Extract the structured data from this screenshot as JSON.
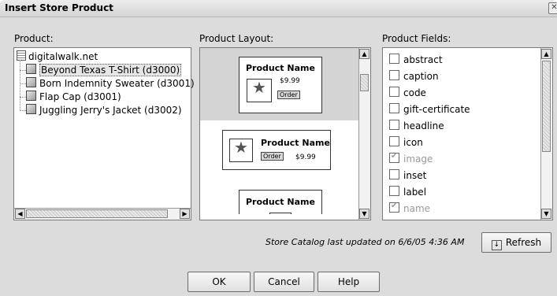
{
  "window": {
    "title": "Insert Store Product",
    "close_icon": "close-icon"
  },
  "product": {
    "label": "Product:",
    "root": "digitalwalk.net",
    "items": [
      {
        "label": "Beyond Texas T-Shirt (d3000)",
        "selected": true
      },
      {
        "label": "Born Indemnity Sweater (d3001)"
      },
      {
        "label": "Flap Cap (d3001)"
      },
      {
        "label": "Juggling Jerry's Jacket (d3002)"
      }
    ]
  },
  "layout": {
    "label": "Product Layout:",
    "cards": [
      {
        "name": "Product Name",
        "price": "$9.99",
        "button": "Order"
      },
      {
        "name": "Product Name",
        "price": "$9.99",
        "button": "Order"
      },
      {
        "name": "Product Name"
      }
    ]
  },
  "fields": {
    "label": "Product Fields:",
    "items": [
      {
        "label": "abstract",
        "checked": false,
        "disabled": false
      },
      {
        "label": "caption",
        "checked": false,
        "disabled": false
      },
      {
        "label": "code",
        "checked": false,
        "disabled": false
      },
      {
        "label": "gift-certificate",
        "checked": false,
        "disabled": false
      },
      {
        "label": "headline",
        "checked": false,
        "disabled": false
      },
      {
        "label": "icon",
        "checked": false,
        "disabled": false
      },
      {
        "label": "image",
        "checked": true,
        "disabled": true
      },
      {
        "label": "inset",
        "checked": false,
        "disabled": false
      },
      {
        "label": "label",
        "checked": false,
        "disabled": false
      },
      {
        "label": "name",
        "checked": true,
        "disabled": true
      }
    ]
  },
  "catalog_note": "Store Catalog last updated on 6/6/05 4:36 AM",
  "buttons": {
    "refresh": "Refresh",
    "ok": "OK",
    "cancel": "Cancel",
    "help": "Help"
  }
}
